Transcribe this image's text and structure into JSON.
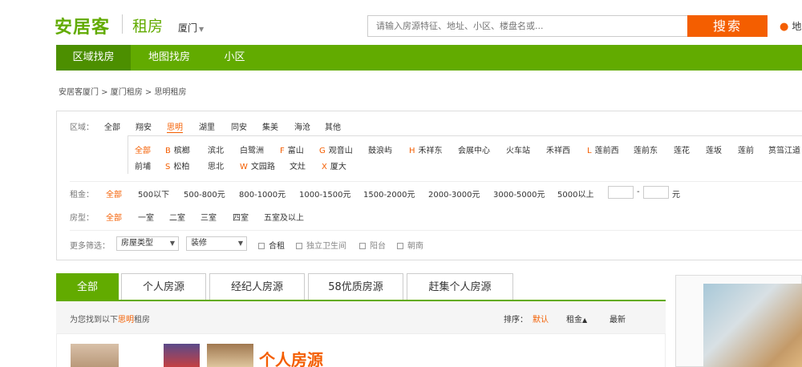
{
  "header": {
    "logo": "安居客",
    "subtitle": "租房",
    "city": "厦门",
    "search_placeholder": "请输入房源特征、地址、小区、楼盘名或...",
    "search_button": "搜索",
    "map_link": "地"
  },
  "nav": {
    "items": [
      {
        "label": "区域找房"
      },
      {
        "label": "地图找房"
      },
      {
        "label": "小区"
      }
    ]
  },
  "breadcrumb": "安居客厦门 > 厦门租房 > 思明租房",
  "filters": {
    "area_label": "区域：",
    "areas": [
      "全部",
      "翔安",
      "思明",
      "湖里",
      "同安",
      "集美",
      "海沧",
      "其他"
    ],
    "subareas_row1": [
      {
        "letter": "",
        "name": "全部"
      },
      {
        "letter": "B",
        "name": "槟榔"
      },
      {
        "letter": "",
        "name": "滨北"
      },
      {
        "letter": "",
        "name": "白鹭洲"
      },
      {
        "letter": "F",
        "name": "富山"
      },
      {
        "letter": "G",
        "name": "观音山"
      },
      {
        "letter": "",
        "name": "鼓浪屿"
      },
      {
        "letter": "H",
        "name": "禾祥东"
      },
      {
        "letter": "",
        "name": "会展中心"
      },
      {
        "letter": "",
        "name": "火车站"
      },
      {
        "letter": "",
        "name": "禾祥西"
      },
      {
        "letter": "L",
        "name": "莲前西"
      },
      {
        "letter": "",
        "name": "莲前东"
      },
      {
        "letter": "",
        "name": "莲花"
      },
      {
        "letter": "",
        "name": "莲坂"
      },
      {
        "letter": "",
        "name": "莲前"
      },
      {
        "letter": "",
        "name": "筼筜江道"
      }
    ],
    "subareas_row2": [
      {
        "letter": "",
        "name": "前埔"
      },
      {
        "letter": "S",
        "name": "松柏"
      },
      {
        "letter": "",
        "name": "思北"
      },
      {
        "letter": "W",
        "name": "文园路"
      },
      {
        "letter": "",
        "name": "文灶"
      },
      {
        "letter": "X",
        "name": "厦大"
      }
    ],
    "rent_label": "租金：",
    "rents": [
      "全部",
      "500以下",
      "500-800元",
      "800-1000元",
      "1000-1500元",
      "1500-2000元",
      "2000-3000元",
      "3000-5000元",
      "5000以上"
    ],
    "rent_sep": "-",
    "rent_unit": "元",
    "room_label": "房型：",
    "rooms": [
      "全部",
      "一室",
      "二室",
      "三室",
      "四室",
      "五室及以上"
    ],
    "more_label": "更多筛选：",
    "house_type_select": "房屋类型",
    "decor_select": "装修",
    "checks": [
      "合租",
      "独立卫生间",
      "阳台",
      "朝南"
    ]
  },
  "tabs": [
    "全部",
    "个人房源",
    "经纪人房源",
    "58优质房源",
    "赶集个人房源"
  ],
  "results": {
    "prefix": "为您找到以下",
    "area": "思明",
    "suffix": "租房",
    "sort_label": "排序：",
    "sort_default": "默认",
    "sort_rent": "租金",
    "sort_latest": "最新"
  },
  "listing": {
    "title": "个人房源"
  },
  "colors": {
    "brand_green": "#62ab00",
    "accent_orange": "#f45e00"
  }
}
